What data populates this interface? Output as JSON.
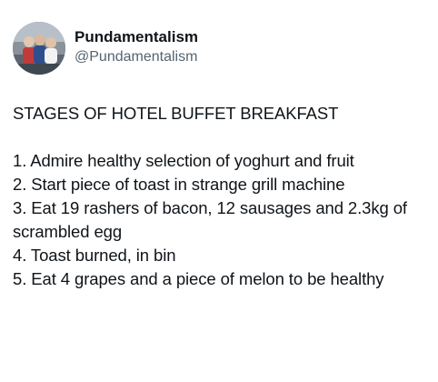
{
  "author": {
    "display_name": "Pundamentalism",
    "handle": "@Pundamentalism",
    "avatar_icon": "profile-photo-avatar"
  },
  "post": {
    "headline": "STAGES OF HOTEL BUFFET BREAKFAST",
    "items": [
      "1. Admire healthy selection of yoghurt and fruit",
      "2. Start piece of toast in strange grill machine",
      "3. Eat 19 rashers of bacon, 12 sausages and 2.3kg of scrambled egg",
      "4. Toast burned, in bin",
      "5. Eat 4 grapes and a piece of melon to be healthy"
    ]
  },
  "colors": {
    "text_primary": "#0f1419",
    "text_secondary": "#536471",
    "background": "#ffffff"
  }
}
